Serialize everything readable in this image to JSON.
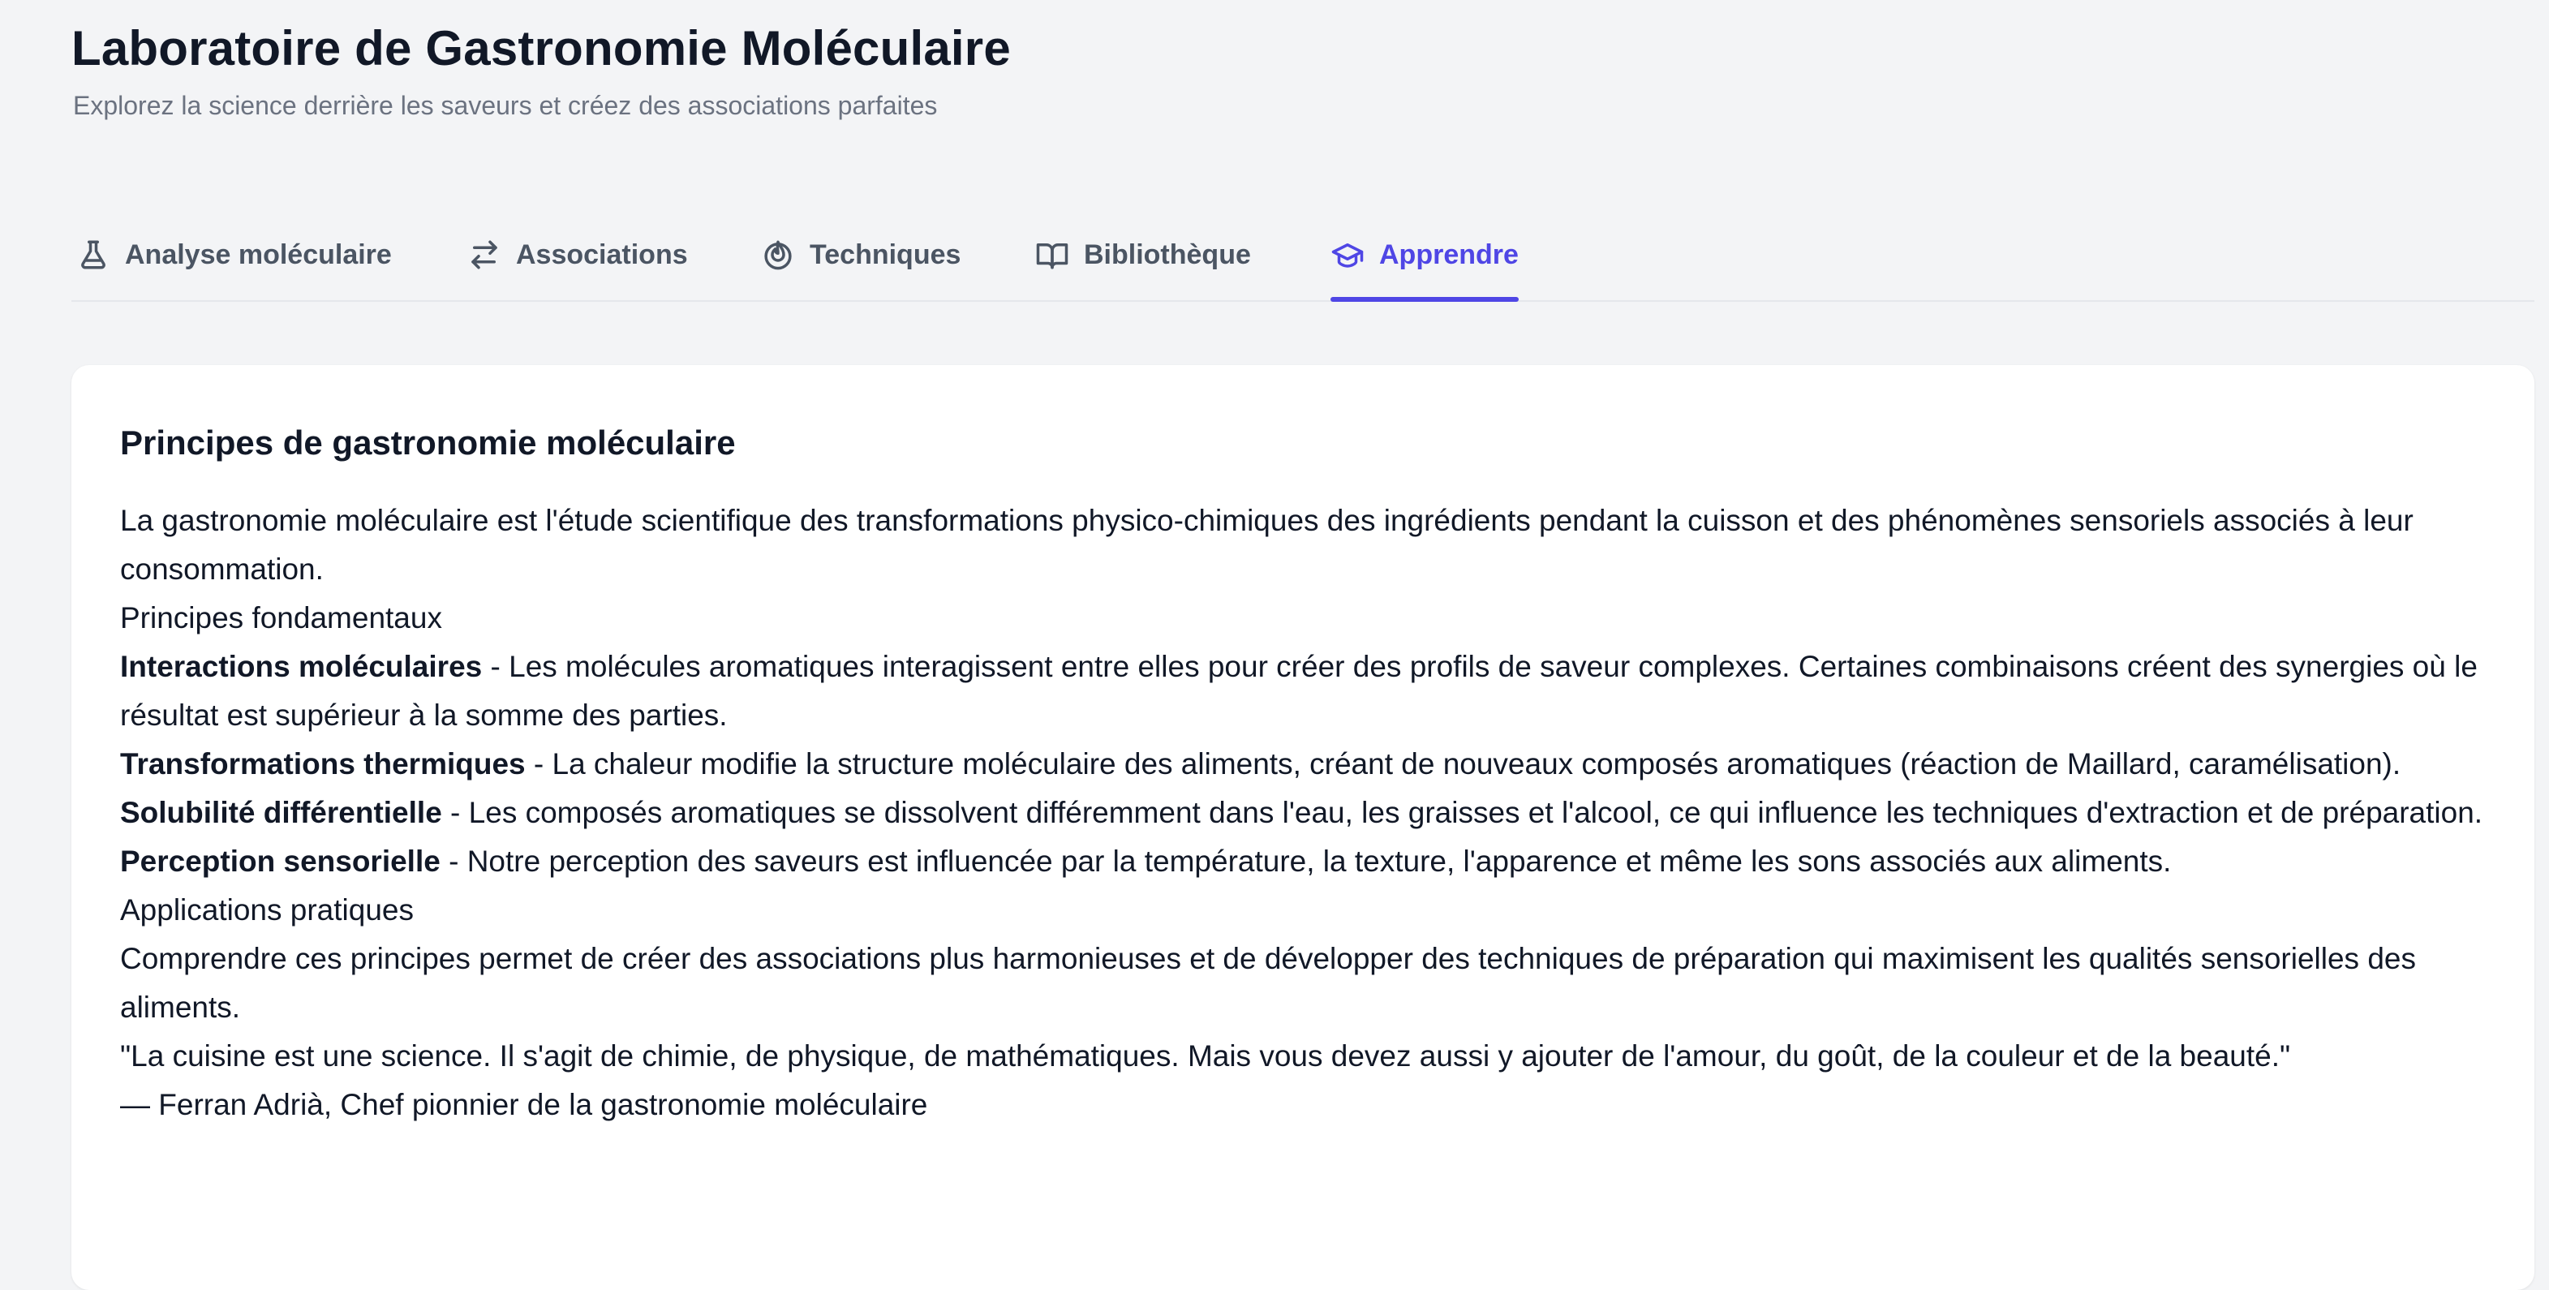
{
  "header": {
    "title": "Laboratoire de Gastronomie Moléculaire",
    "subtitle": "Explorez la science derrière les saveurs et créez des associations parfaites"
  },
  "tabs": [
    {
      "label": "Analyse moléculaire",
      "icon": "flask-icon"
    },
    {
      "label": "Associations",
      "icon": "arrows-swap-icon"
    },
    {
      "label": "Techniques",
      "icon": "flame-icon"
    },
    {
      "label": "Bibliothèque",
      "icon": "book-icon"
    },
    {
      "label": "Apprendre",
      "icon": "graduation-cap-icon",
      "active": true
    }
  ],
  "colors": {
    "accent": "#4f46e5",
    "background": "#f3f4f6",
    "card": "#ffffff",
    "text": "#111827",
    "muted": "#6b7280"
  },
  "learn": {
    "title": "Principes de gastronomie moléculaire",
    "intro": "La gastronomie moléculaire est l'étude scientifique des transformations physico-chimiques des ingrédients pendant la cuisson et des phénomènes sensoriels associés à leur consommation.",
    "fundamentals_heading": "Principes fondamentaux",
    "principles": [
      {
        "term": "Interactions moléculaires",
        "description": " - Les molécules aromatiques interagissent entre elles pour créer des profils de saveur complexes. Certaines combinaisons créent des synergies où le résultat est supérieur à la somme des parties."
      },
      {
        "term": "Transformations thermiques",
        "description": " - La chaleur modifie la structure moléculaire des aliments, créant de nouveaux composés aromatiques (réaction de Maillard, caramélisation)."
      },
      {
        "term": "Solubilité différentielle",
        "description": " - Les composés aromatiques se dissolvent différemment dans l'eau, les graisses et l'alcool, ce qui influence les techniques d'extraction et de préparation."
      },
      {
        "term": "Perception sensorielle",
        "description": " - Notre perception des saveurs est influencée par la température, la texture, l'apparence et même les sons associés aux aliments."
      }
    ],
    "applications_heading": "Applications pratiques",
    "applications_text": "Comprendre ces principes permet de créer des associations plus harmonieuses et de développer des techniques de préparation qui maximisent les qualités sensorielles des aliments.",
    "quote": "\"La cuisine est une science. Il s'agit de chimie, de physique, de mathématiques. Mais vous devez aussi y ajouter de l'amour, du goût, de la couleur et de la beauté.\"",
    "quote_author": "— Ferran Adrià, Chef pionnier de la gastronomie moléculaire"
  }
}
